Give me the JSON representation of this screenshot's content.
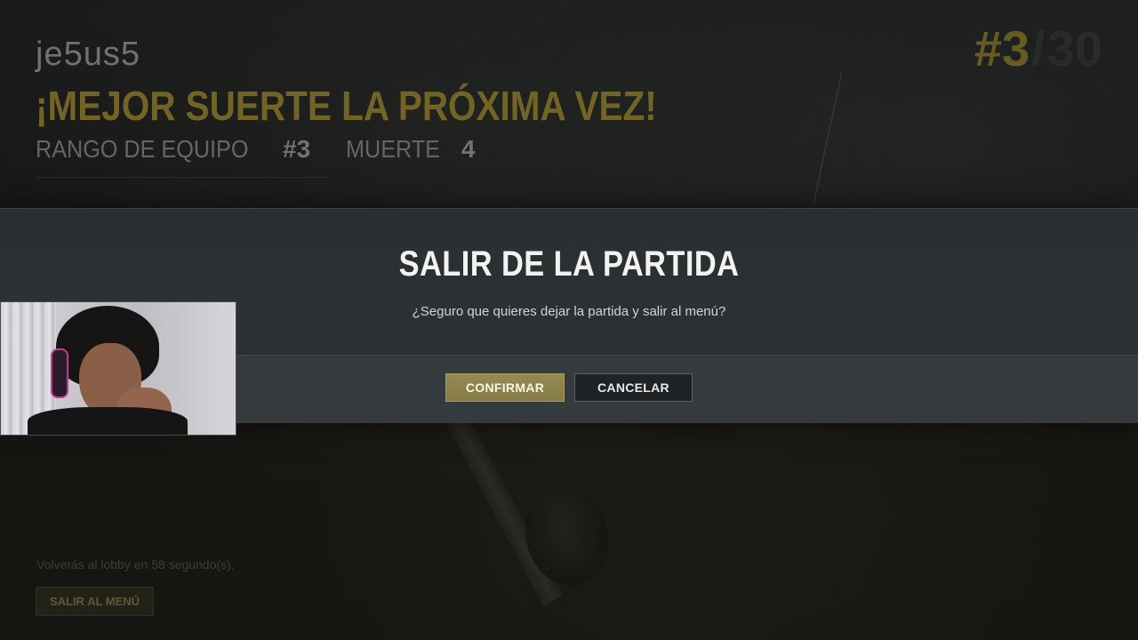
{
  "player": {
    "name": "je5us5",
    "result_message": "¡MEJOR SUERTE LA PRÓXIMA VEZ!"
  },
  "stats": [
    {
      "label": "RANGO DE EQUIPO",
      "value": "#3"
    },
    {
      "label": "MUERTE",
      "value": "4"
    }
  ],
  "placement": {
    "rank": "#3",
    "separator": "/",
    "total": "30"
  },
  "dialog": {
    "title": "SALIR DE LA PARTIDA",
    "message": "¿Seguro que quieres dejar la partida y salir al menú?",
    "confirm_label": "CONFIRMAR",
    "cancel_label": "CANCELAR"
  },
  "footer": {
    "countdown_text": "Volverás al lobby en 58 segundo(s).",
    "exit_menu_label": "SALIR AL MENÚ"
  },
  "colors": {
    "accent_gold": "#8a7a2e",
    "confirm_button": "#948a52",
    "dialog_bg": "#2c3134"
  }
}
